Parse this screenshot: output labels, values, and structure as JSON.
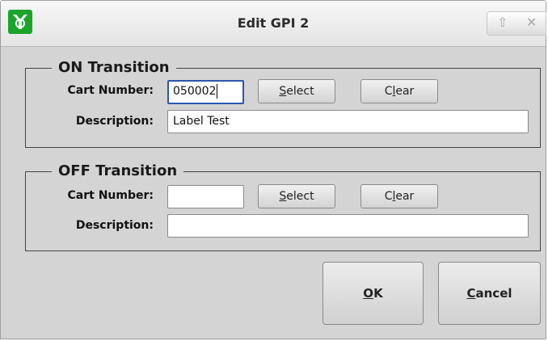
{
  "window": {
    "title": "Edit GPI 2",
    "controls": [
      {
        "icon": "up-arrow-icon",
        "glyph": "⇧"
      },
      {
        "icon": "close-icon",
        "glyph": "✕"
      }
    ],
    "app_icon": "gpi-app-icon",
    "app_icon_color": "#1aa52a"
  },
  "on_transition": {
    "title": "ON Transition",
    "cart_number_label": "Cart Number:",
    "cart_number_value": "050002",
    "description_label": "Description:",
    "description_value": "Label Test",
    "select_button": {
      "pre": "",
      "key": "S",
      "post": "elect"
    },
    "clear_button": {
      "pre": "C",
      "key": "l",
      "post": "ear"
    }
  },
  "off_transition": {
    "title": "OFF Transition",
    "cart_number_label": "Cart Number:",
    "cart_number_value": "",
    "description_label": "Description:",
    "description_value": "",
    "select_button": {
      "pre": "",
      "key": "S",
      "post": "elect"
    },
    "clear_button": {
      "pre": "C",
      "key": "l",
      "post": "ear"
    }
  },
  "dialog_buttons": {
    "ok": {
      "pre": "",
      "key": "O",
      "post": "K"
    },
    "cancel": {
      "pre": "",
      "key": "C",
      "post": "ancel"
    }
  },
  "colors": {
    "focus_border": "#2a57b0"
  }
}
